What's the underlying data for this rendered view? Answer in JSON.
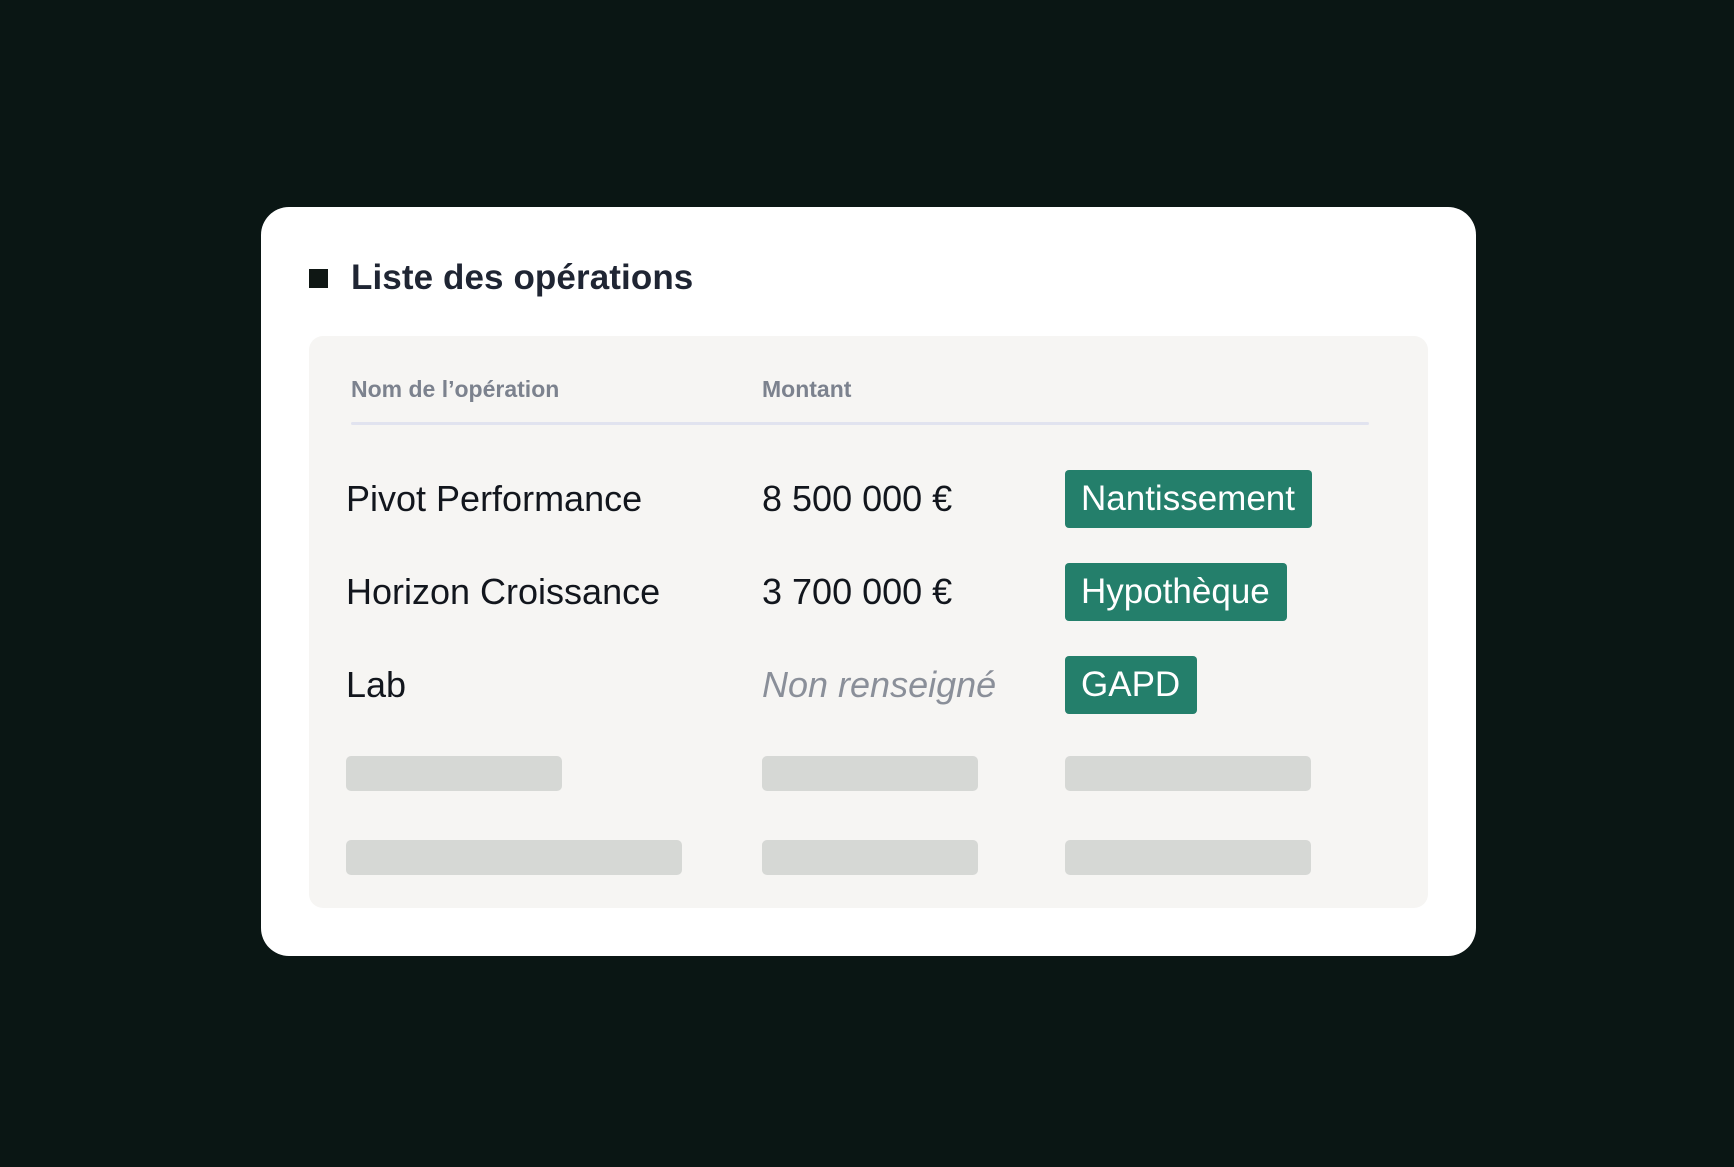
{
  "panel": {
    "title": "Liste des opérations"
  },
  "table": {
    "columns": [
      "Nom de l’opération",
      "Montant"
    ],
    "rows": [
      {
        "name": "Pivot Performance",
        "amount": "8 500 000 €",
        "tag": "Nantissement"
      },
      {
        "name": "Horizon Croissance",
        "amount": "3 700 000 €",
        "tag": "Hypothèque"
      },
      {
        "name": "Lab",
        "amount": "Non renseigné",
        "tag": "GAPD"
      }
    ],
    "placeholder_rows": 2
  },
  "colors": {
    "background": "#0a1614",
    "card": "#ffffff",
    "table_bg": "#f6f5f3",
    "tag": "#247f6b",
    "skeleton": "#d6d8d5"
  },
  "icons": [
    "square-bullet-icon"
  ]
}
